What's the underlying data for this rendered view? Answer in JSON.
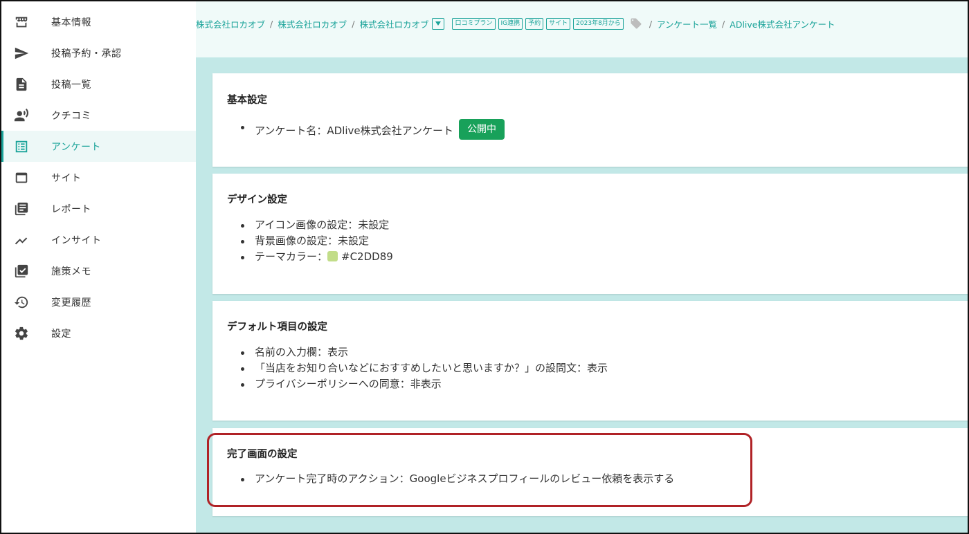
{
  "sidebar": {
    "items": [
      {
        "label": "基本情報",
        "icon": "storefront-icon"
      },
      {
        "label": "投稿予約・承認",
        "icon": "send-icon"
      },
      {
        "label": "投稿一覧",
        "icon": "document-icon"
      },
      {
        "label": "クチコミ",
        "icon": "voice-icon"
      },
      {
        "label": "アンケート",
        "icon": "list-icon",
        "active": true
      },
      {
        "label": "サイト",
        "icon": "window-icon"
      },
      {
        "label": "レポート",
        "icon": "report-icon"
      },
      {
        "label": "インサイト",
        "icon": "trend-icon"
      },
      {
        "label": "施策メモ",
        "icon": "checklist-icon"
      },
      {
        "label": "変更履歴",
        "icon": "history-icon"
      },
      {
        "label": "設定",
        "icon": "gear-icon"
      }
    ]
  },
  "breadcrumb": {
    "company1": "株式会社ロカオブ",
    "company2": "株式会社ロカオブ",
    "company3": "株式会社ロカオブ",
    "tags": [
      "口コミプラン",
      "IG連携",
      "予約",
      "サイト",
      "2023年8月から"
    ],
    "survey_list": "アンケート一覧",
    "current": "ADlive株式会社アンケート",
    "separator": "/"
  },
  "cards": {
    "basic": {
      "title": "基本設定",
      "survey_name": "アンケート名：ADlive株式会社アンケート",
      "status_badge": "公開中"
    },
    "design": {
      "title": "デザイン設定",
      "icon_image": "アイコン画像の設定：未設定",
      "bg_image": "背景画像の設定：未設定",
      "theme_color_label": "テーマカラー：",
      "theme_color_value": "#C2DD89"
    },
    "default_items": {
      "title": "デフォルト項目の設定",
      "name_field": "名前の入力欄：表示",
      "recommend_question": "「当店をお知り合いなどにおすすめしたいと思いますか？」の設問文：表示",
      "privacy_consent": "プライバシーポリシーへの同意：非表示"
    },
    "completion": {
      "title": "完了画面の設定",
      "action": "アンケート完了時のアクション：Googleビジネスプロフィールのレビュー依頼を表示する"
    }
  },
  "colors": {
    "accent": "#1aa399",
    "main_bg": "#c2e8e7",
    "badge_green": "#18a15a",
    "theme_swatch": "#C2DD89",
    "highlight_red": "#b02226"
  }
}
